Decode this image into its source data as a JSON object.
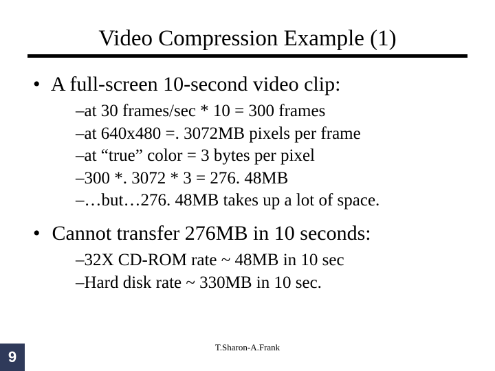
{
  "title": "Video Compression Example (1)",
  "bullets": [
    {
      "text": "A full-screen 10-second video clip:",
      "subs": [
        "at 30 frames/sec * 10 = 300 frames",
        "at 640x480 =. 3072MB pixels per frame",
        "at “true” color = 3 bytes per pixel",
        "300 *. 3072 * 3 = 276. 48MB",
        "…but…276. 48MB takes up a lot of space."
      ]
    },
    {
      "text": "Cannot transfer 276MB in 10 seconds:",
      "subs": [
        "32X CD-ROM rate ~ 48MB in 10 sec",
        "Hard disk rate ~ 330MB in 10 sec."
      ]
    }
  ],
  "footer": "T.Sharon-A.Frank",
  "page_number": "9"
}
